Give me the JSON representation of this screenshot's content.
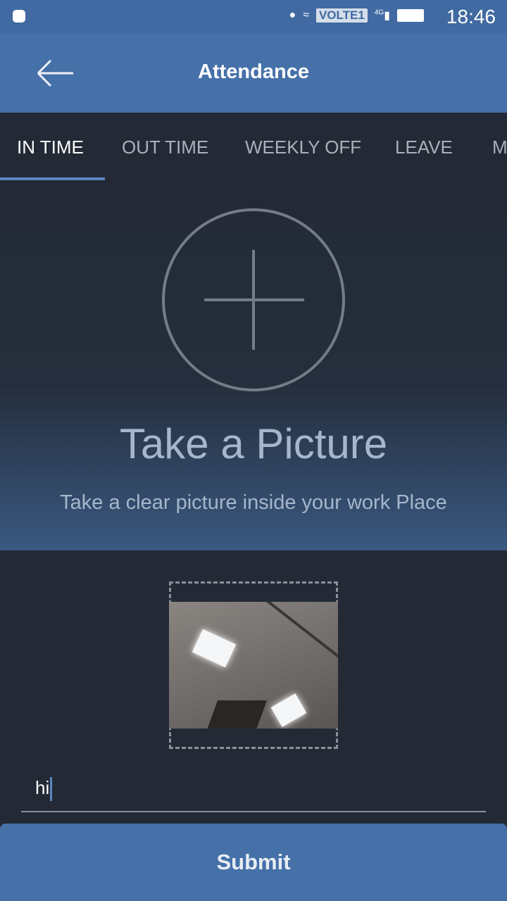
{
  "status_bar": {
    "time": "18:46",
    "network_badge": "VOLTE1",
    "network_type": "4G",
    "icons": [
      "android-icon",
      "location-icon",
      "wifi-icon",
      "signal-icon",
      "battery-icon"
    ]
  },
  "app_bar": {
    "title": "Attendance",
    "back_icon": "arrow-left-icon"
  },
  "tabs": [
    {
      "label": "IN TIME",
      "active": true
    },
    {
      "label": "OUT TIME"
    },
    {
      "label": "WEEKLY OFF"
    },
    {
      "label": "LEAVE"
    },
    {
      "label": "M"
    }
  ],
  "capture": {
    "icon": "plus-circle-icon",
    "title": "Take a Picture",
    "subtitle": "Take a clear picture inside your work Place"
  },
  "form": {
    "remark_value": "hi",
    "submit_label": "Submit"
  },
  "colors": {
    "primary": "#4570a8",
    "background": "#232a36",
    "accent": "#5b87c2"
  }
}
